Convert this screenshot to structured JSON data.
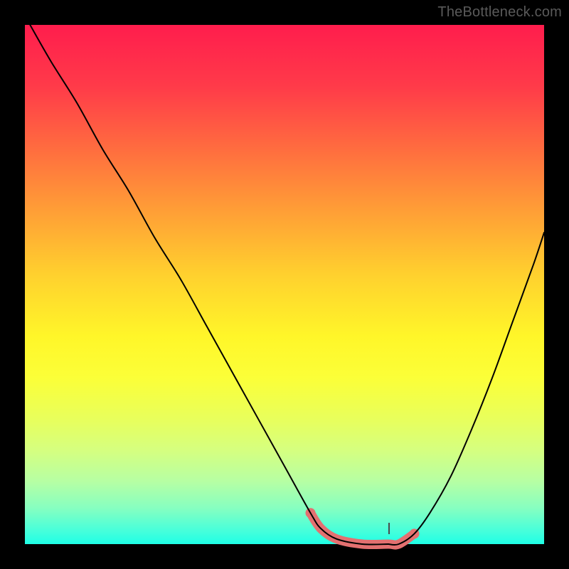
{
  "watermark": "TheBottleneck.com",
  "chart_data": {
    "type": "line",
    "title": "",
    "xlabel": "",
    "ylabel": "",
    "xlim": [
      0,
      100
    ],
    "ylim": [
      0,
      100
    ],
    "background_gradient": {
      "type": "vertical",
      "stops": [
        {
          "pos": 0.0,
          "color": "#ff1d4d"
        },
        {
          "pos": 0.5,
          "color": "#ffd02e"
        },
        {
          "pos": 0.7,
          "color": "#fbff38"
        },
        {
          "pos": 1.0,
          "color": "#1fffe6"
        }
      ]
    },
    "series": [
      {
        "name": "left-branch",
        "x": [
          1,
          5,
          10,
          15,
          20,
          25,
          30,
          35,
          40,
          45,
          50,
          55,
          57,
          60,
          65,
          70
        ],
        "y": [
          100,
          93,
          85,
          76,
          68,
          59,
          51,
          42,
          33,
          24,
          15,
          6,
          3,
          1,
          0,
          0
        ]
      },
      {
        "name": "right-branch",
        "x": [
          70,
          72,
          75,
          78,
          82,
          86,
          90,
          94,
          98,
          100
        ],
        "y": [
          0,
          0,
          2,
          6,
          13,
          22,
          32,
          43,
          54,
          60
        ]
      }
    ],
    "highlight_segment": {
      "name": "bottom-salmon",
      "color": "#e37070",
      "x": [
        55,
        57,
        60,
        65,
        70,
        72,
        75
      ],
      "y": [
        6,
        3,
        1,
        0,
        0,
        0,
        2
      ]
    },
    "annotations": []
  }
}
